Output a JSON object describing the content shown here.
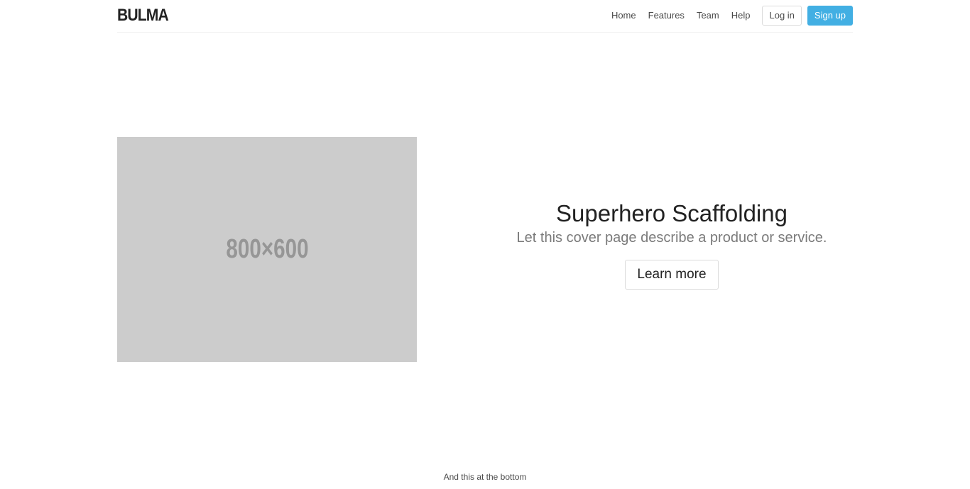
{
  "brand": {
    "logo_text": "BULMA"
  },
  "nav": {
    "links": [
      "Home",
      "Features",
      "Team",
      "Help"
    ],
    "login_label": "Log in",
    "signup_label": "Sign up",
    "accent_color": "#42afe3"
  },
  "hero": {
    "image_placeholder": "800×600",
    "title": "Superhero Scaffolding",
    "subtitle": "Let this cover page describe a product or service.",
    "cta_label": "Learn more"
  },
  "footer": {
    "text": "And this at the bottom"
  }
}
